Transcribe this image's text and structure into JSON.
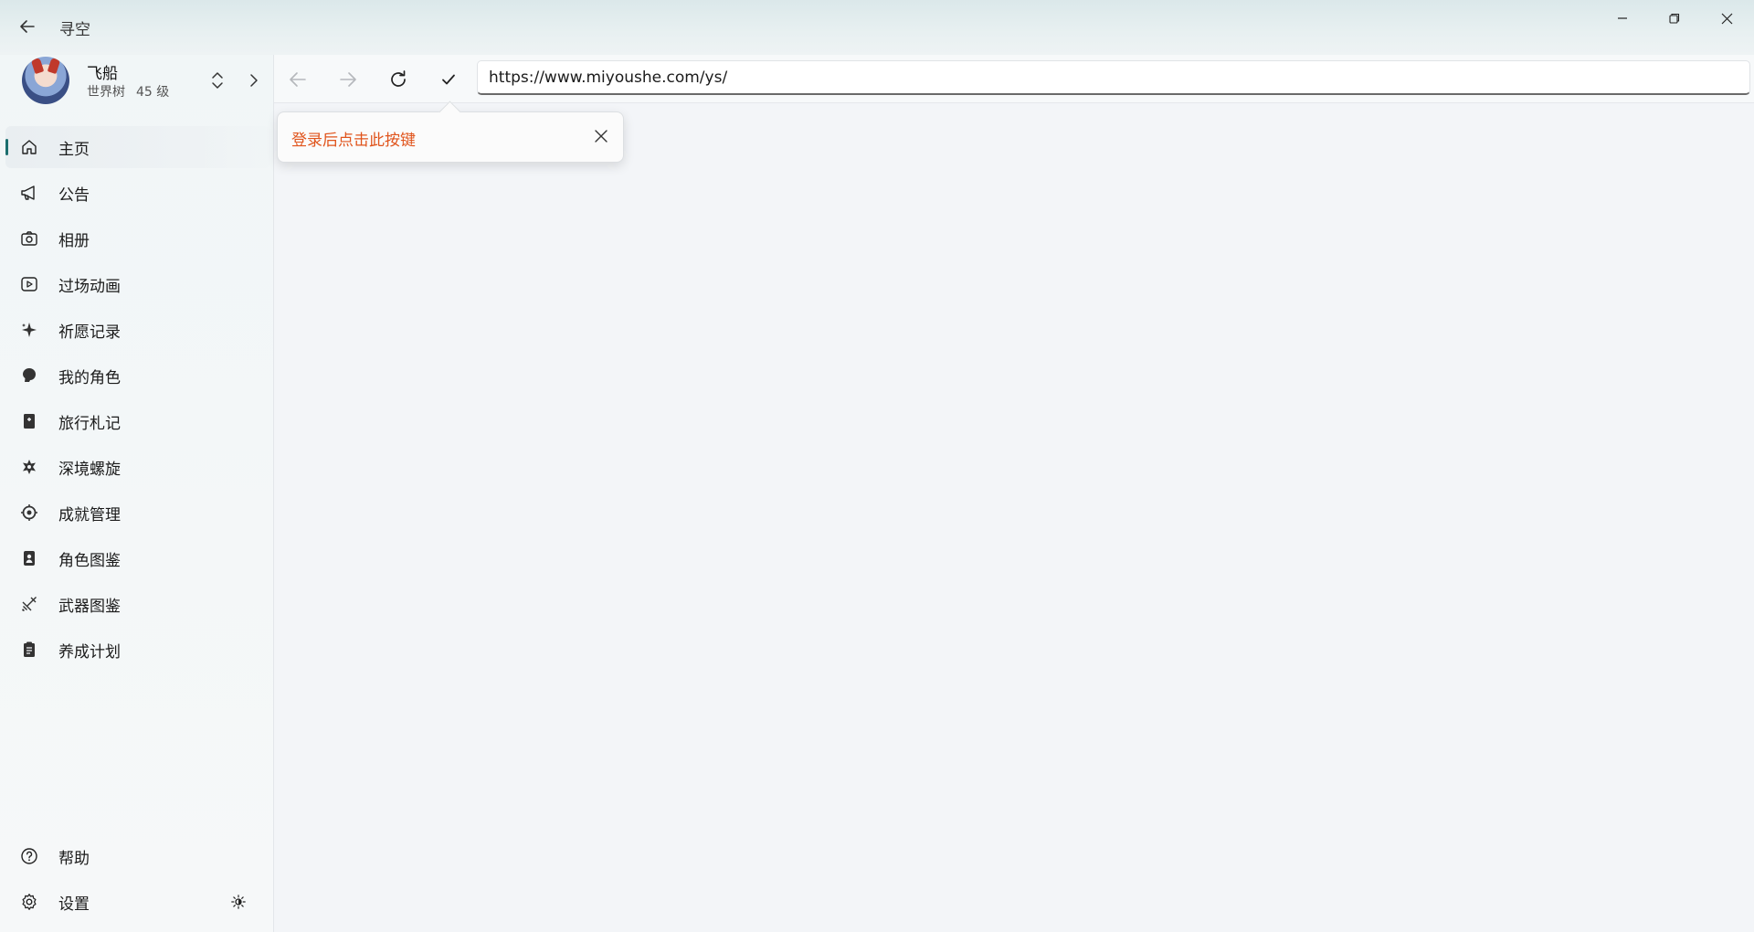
{
  "window": {
    "title": "寻空"
  },
  "profile": {
    "name": "飞船",
    "server": "世界树",
    "level": "45 级"
  },
  "sidebar": {
    "items": [
      {
        "label": "主页",
        "icon": "home-icon",
        "active": true
      },
      {
        "label": "公告",
        "icon": "megaphone-icon"
      },
      {
        "label": "相册",
        "icon": "camera-icon"
      },
      {
        "label": "过场动画",
        "icon": "video-icon"
      },
      {
        "label": "祈愿记录",
        "icon": "sparkle-icon"
      },
      {
        "label": "我的角色",
        "icon": "character-head-icon"
      },
      {
        "label": "旅行札记",
        "icon": "notebook-icon"
      },
      {
        "label": "深境螺旋",
        "icon": "abyss-star-icon"
      },
      {
        "label": "成就管理",
        "icon": "achievement-icon"
      },
      {
        "label": "角色图鉴",
        "icon": "character-card-icon"
      },
      {
        "label": "武器图鉴",
        "icon": "weapon-icon"
      },
      {
        "label": "养成计划",
        "icon": "clipboard-icon"
      }
    ],
    "footer": [
      {
        "label": "帮助",
        "icon": "help-icon"
      },
      {
        "label": "设置",
        "icon": "gear-icon"
      }
    ]
  },
  "browser": {
    "url": "https://www.miyoushe.com/ys/"
  },
  "tip": {
    "text": "登录后点击此按键"
  },
  "colors": {
    "accent": "#1c6e6e",
    "tip_text": "#e0541c"
  }
}
